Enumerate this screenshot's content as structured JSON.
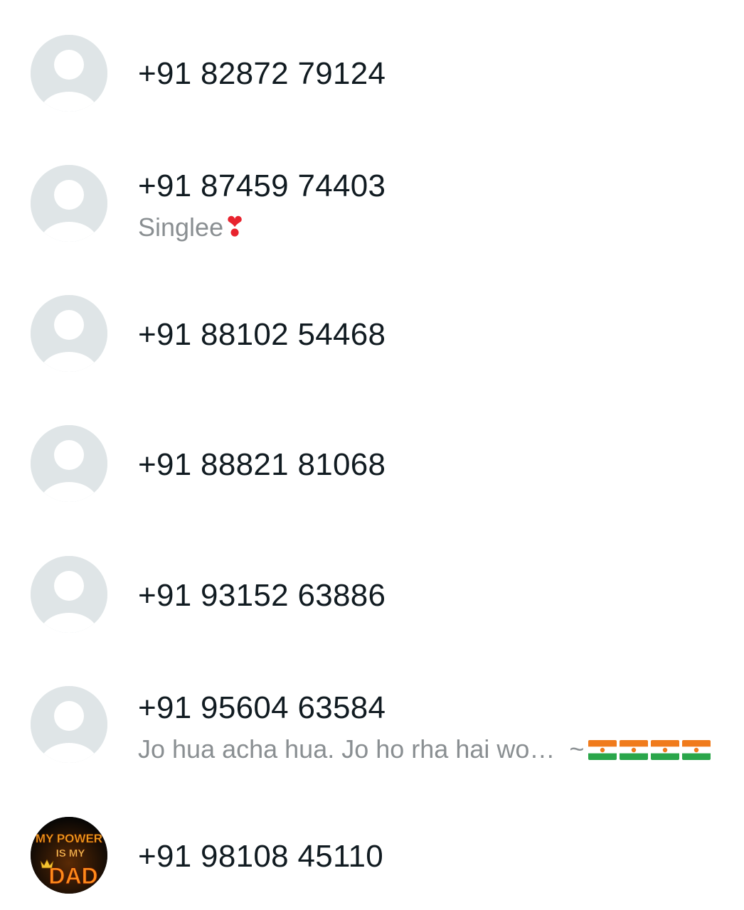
{
  "contacts": [
    {
      "phone": "+91 82872 79124",
      "about": ""
    },
    {
      "phone": "+91 87459 74403",
      "about": "Singlee",
      "about_emoji": "❣"
    },
    {
      "phone": "+91 88102 54468",
      "about": ""
    },
    {
      "phone": "+91 88821 81068",
      "about": ""
    },
    {
      "phone": "+91 93152 63886",
      "about": ""
    },
    {
      "phone": "+91 95604 63584",
      "about": "Jo hua acha hua. Jo ho rha hai wo…",
      "about_suffix": "~"
    },
    {
      "phone": "+91 98108 45110",
      "about": "",
      "avatar_text": [
        "MY POWER",
        "IS MY",
        "DAD"
      ]
    }
  ],
  "icons": {
    "default_avatar": "person-silhouette-icon",
    "heart": "heavy-heart-exclamation-icon",
    "flag": "flag-icon"
  },
  "colors": {
    "phone_text": "#111b21",
    "about_text": "#8a8f92",
    "avatar_bg": "#dfe5e7",
    "avatar_fg": "#ffffff"
  }
}
